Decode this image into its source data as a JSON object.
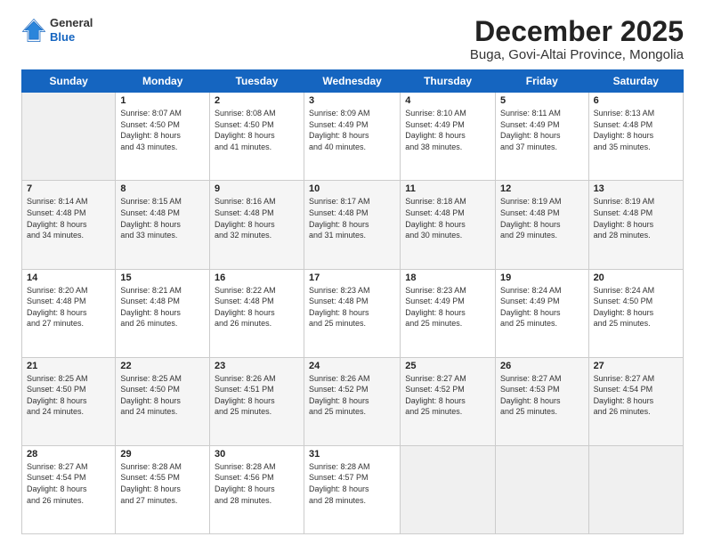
{
  "logo": {
    "general": "General",
    "blue": "Blue"
  },
  "title": "December 2025",
  "subtitle": "Buga, Govi-Altai Province, Mongolia",
  "days_of_week": [
    "Sunday",
    "Monday",
    "Tuesday",
    "Wednesday",
    "Thursday",
    "Friday",
    "Saturday"
  ],
  "weeks": [
    [
      {
        "day": "",
        "detail": ""
      },
      {
        "day": "1",
        "detail": "Sunrise: 8:07 AM\nSunset: 4:50 PM\nDaylight: 8 hours\nand 43 minutes."
      },
      {
        "day": "2",
        "detail": "Sunrise: 8:08 AM\nSunset: 4:50 PM\nDaylight: 8 hours\nand 41 minutes."
      },
      {
        "day": "3",
        "detail": "Sunrise: 8:09 AM\nSunset: 4:49 PM\nDaylight: 8 hours\nand 40 minutes."
      },
      {
        "day": "4",
        "detail": "Sunrise: 8:10 AM\nSunset: 4:49 PM\nDaylight: 8 hours\nand 38 minutes."
      },
      {
        "day": "5",
        "detail": "Sunrise: 8:11 AM\nSunset: 4:49 PM\nDaylight: 8 hours\nand 37 minutes."
      },
      {
        "day": "6",
        "detail": "Sunrise: 8:13 AM\nSunset: 4:48 PM\nDaylight: 8 hours\nand 35 minutes."
      }
    ],
    [
      {
        "day": "7",
        "detail": "Sunrise: 8:14 AM\nSunset: 4:48 PM\nDaylight: 8 hours\nand 34 minutes."
      },
      {
        "day": "8",
        "detail": "Sunrise: 8:15 AM\nSunset: 4:48 PM\nDaylight: 8 hours\nand 33 minutes."
      },
      {
        "day": "9",
        "detail": "Sunrise: 8:16 AM\nSunset: 4:48 PM\nDaylight: 8 hours\nand 32 minutes."
      },
      {
        "day": "10",
        "detail": "Sunrise: 8:17 AM\nSunset: 4:48 PM\nDaylight: 8 hours\nand 31 minutes."
      },
      {
        "day": "11",
        "detail": "Sunrise: 8:18 AM\nSunset: 4:48 PM\nDaylight: 8 hours\nand 30 minutes."
      },
      {
        "day": "12",
        "detail": "Sunrise: 8:19 AM\nSunset: 4:48 PM\nDaylight: 8 hours\nand 29 minutes."
      },
      {
        "day": "13",
        "detail": "Sunrise: 8:19 AM\nSunset: 4:48 PM\nDaylight: 8 hours\nand 28 minutes."
      }
    ],
    [
      {
        "day": "14",
        "detail": "Sunrise: 8:20 AM\nSunset: 4:48 PM\nDaylight: 8 hours\nand 27 minutes."
      },
      {
        "day": "15",
        "detail": "Sunrise: 8:21 AM\nSunset: 4:48 PM\nDaylight: 8 hours\nand 26 minutes."
      },
      {
        "day": "16",
        "detail": "Sunrise: 8:22 AM\nSunset: 4:48 PM\nDaylight: 8 hours\nand 26 minutes."
      },
      {
        "day": "17",
        "detail": "Sunrise: 8:23 AM\nSunset: 4:48 PM\nDaylight: 8 hours\nand 25 minutes."
      },
      {
        "day": "18",
        "detail": "Sunrise: 8:23 AM\nSunset: 4:49 PM\nDaylight: 8 hours\nand 25 minutes."
      },
      {
        "day": "19",
        "detail": "Sunrise: 8:24 AM\nSunset: 4:49 PM\nDaylight: 8 hours\nand 25 minutes."
      },
      {
        "day": "20",
        "detail": "Sunrise: 8:24 AM\nSunset: 4:50 PM\nDaylight: 8 hours\nand 25 minutes."
      }
    ],
    [
      {
        "day": "21",
        "detail": "Sunrise: 8:25 AM\nSunset: 4:50 PM\nDaylight: 8 hours\nand 24 minutes."
      },
      {
        "day": "22",
        "detail": "Sunrise: 8:25 AM\nSunset: 4:50 PM\nDaylight: 8 hours\nand 24 minutes."
      },
      {
        "day": "23",
        "detail": "Sunrise: 8:26 AM\nSunset: 4:51 PM\nDaylight: 8 hours\nand 25 minutes."
      },
      {
        "day": "24",
        "detail": "Sunrise: 8:26 AM\nSunset: 4:52 PM\nDaylight: 8 hours\nand 25 minutes."
      },
      {
        "day": "25",
        "detail": "Sunrise: 8:27 AM\nSunset: 4:52 PM\nDaylight: 8 hours\nand 25 minutes."
      },
      {
        "day": "26",
        "detail": "Sunrise: 8:27 AM\nSunset: 4:53 PM\nDaylight: 8 hours\nand 25 minutes."
      },
      {
        "day": "27",
        "detail": "Sunrise: 8:27 AM\nSunset: 4:54 PM\nDaylight: 8 hours\nand 26 minutes."
      }
    ],
    [
      {
        "day": "28",
        "detail": "Sunrise: 8:27 AM\nSunset: 4:54 PM\nDaylight: 8 hours\nand 26 minutes."
      },
      {
        "day": "29",
        "detail": "Sunrise: 8:28 AM\nSunset: 4:55 PM\nDaylight: 8 hours\nand 27 minutes."
      },
      {
        "day": "30",
        "detail": "Sunrise: 8:28 AM\nSunset: 4:56 PM\nDaylight: 8 hours\nand 28 minutes."
      },
      {
        "day": "31",
        "detail": "Sunrise: 8:28 AM\nSunset: 4:57 PM\nDaylight: 8 hours\nand 28 minutes."
      },
      {
        "day": "",
        "detail": ""
      },
      {
        "day": "",
        "detail": ""
      },
      {
        "day": "",
        "detail": ""
      }
    ]
  ]
}
